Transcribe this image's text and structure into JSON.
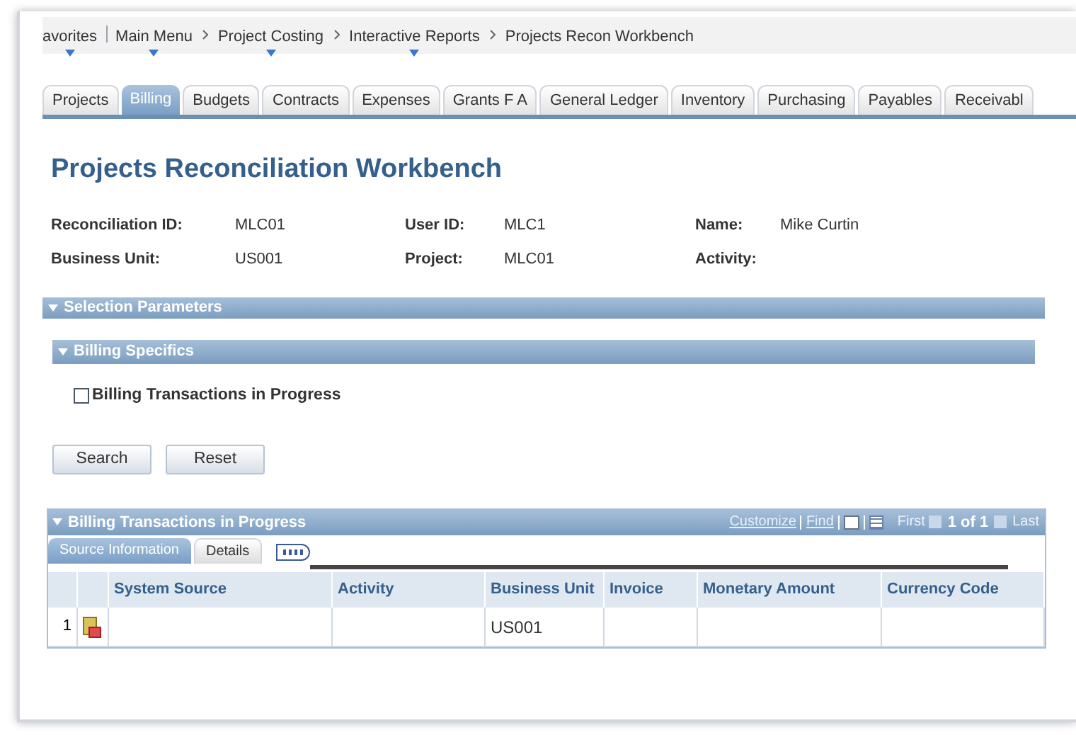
{
  "breadcrumbs": [
    {
      "label": "avorites",
      "menu": true
    },
    {
      "label": "Main Menu",
      "menu": true
    },
    {
      "label": "Project Costing",
      "menu": true
    },
    {
      "label": "Interactive Reports",
      "menu": true
    },
    {
      "label": "Projects Recon Workbench",
      "menu": false
    }
  ],
  "tabs": [
    {
      "label": "Projects",
      "selected": false
    },
    {
      "label": "Billing",
      "selected": true
    },
    {
      "label": "Budgets",
      "selected": false
    },
    {
      "label": "Contracts",
      "selected": false
    },
    {
      "label": "Expenses",
      "selected": false
    },
    {
      "label": "Grants F A",
      "selected": false
    },
    {
      "label": "General Ledger",
      "selected": false
    },
    {
      "label": "Inventory",
      "selected": false
    },
    {
      "label": "Purchasing",
      "selected": false
    },
    {
      "label": "Payables",
      "selected": false
    },
    {
      "label": "Receivabl",
      "selected": false
    }
  ],
  "title": "Projects Reconciliation Workbench",
  "fields": [
    {
      "label": "Reconciliation ID:",
      "value": "MLC01"
    },
    {
      "label": "User ID:",
      "value": "MLC1"
    },
    {
      "label": "Name:",
      "value": "Mike Curtin"
    },
    {
      "label": "Business Unit:",
      "value": "US001"
    },
    {
      "label": "Project:",
      "value": "MLC01"
    },
    {
      "label": "Activity:"
    }
  ],
  "selection_section": {
    "title": "Selection Parameters",
    "expanded": true
  },
  "billing_section": {
    "title": "Billing Specifics",
    "expanded": true
  },
  "checkbox": {
    "label": "Billing Transactions in Progress",
    "checked": false
  },
  "buttons": [
    "Search",
    "Reset"
  ],
  "grid": {
    "title": "Billing Transactions in Progress",
    "expanded": true,
    "links": [
      "Customize",
      "Find"
    ],
    "nav": {
      "first": "First",
      "count": "1 of 1",
      "last": "Last"
    },
    "tabs": [
      {
        "label": "Source Information",
        "selected": true
      },
      {
        "label": "Details",
        "selected": false
      }
    ],
    "columns": [
      "System Source",
      "Activity",
      "Business Unit",
      "Invoice",
      "Monetary Amount",
      "Currency Code"
    ],
    "rows": [
      {
        "number": "1",
        "cells": [
          "",
          "",
          "US001",
          "",
          "",
          ""
        ]
      }
    ]
  }
}
